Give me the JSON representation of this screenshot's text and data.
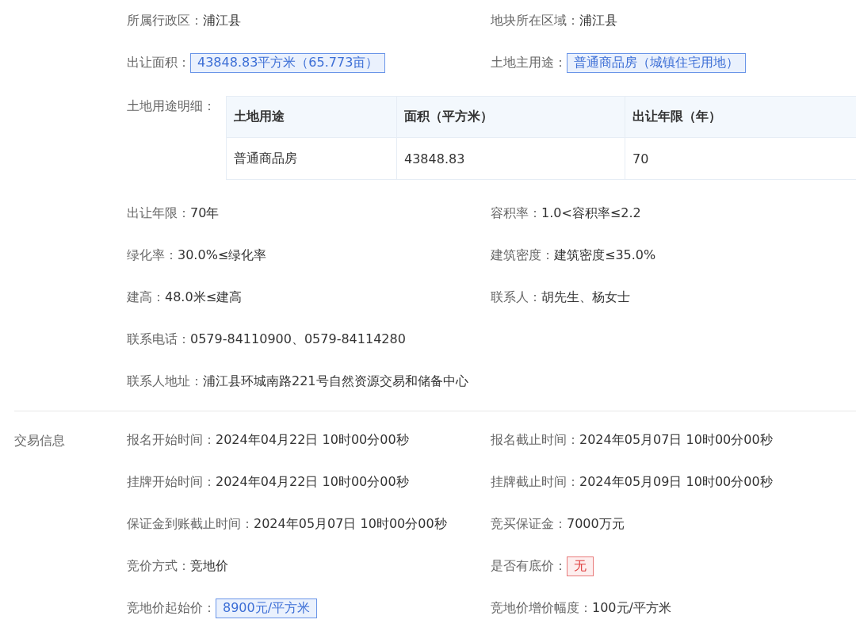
{
  "sections": [
    {
      "items": [
        {
          "kind": "text",
          "label": "所属行政区：",
          "value": "浦江县"
        },
        {
          "kind": "text",
          "label": "地块所在区域：",
          "value": "浦江县"
        },
        {
          "kind": "tag",
          "label": "出让面积：",
          "value": "43848.83平方米（65.773亩）"
        },
        {
          "kind": "tag",
          "label": "土地主用途：",
          "value": "普通商品房（城镇住宅用地）"
        },
        {
          "kind": "table",
          "label": "土地用途明细：",
          "columns": [
            "土地用途",
            "面积（平方米）",
            "出让年限（年）"
          ],
          "rows": [
            [
              "普通商品房",
              "43848.83",
              "70"
            ]
          ]
        },
        {
          "kind": "text",
          "label": "出让年限：",
          "value": "70年"
        },
        {
          "kind": "text",
          "label": "容积率：",
          "value": "1.0<容积率≤2.2"
        },
        {
          "kind": "text",
          "label": "绿化率：",
          "value": "30.0%≤绿化率"
        },
        {
          "kind": "text",
          "label": "建筑密度：",
          "value": "建筑密度≤35.0%"
        },
        {
          "kind": "text",
          "label": "建高：",
          "value": "48.0米≤建高"
        },
        {
          "kind": "text",
          "label": "联系人：",
          "value": "胡先生、杨女士"
        },
        {
          "kind": "wide",
          "label": "联系电话：",
          "value": "0579-84110900、0579-84114280"
        },
        {
          "kind": "wide",
          "label": "联系人地址：",
          "value": "浦江县环城南路221号自然资源交易和储备中心"
        }
      ]
    },
    {
      "title": "交易信息",
      "items": [
        {
          "kind": "text",
          "label": "报名开始时间：",
          "value": "2024年04月22日 10时00分00秒"
        },
        {
          "kind": "text",
          "label": "报名截止时间：",
          "value": "2024年05月07日 10时00分00秒"
        },
        {
          "kind": "text",
          "label": "挂牌开始时间：",
          "value": "2024年04月22日 10时00分00秒"
        },
        {
          "kind": "text",
          "label": "挂牌截止时间：",
          "value": "2024年05月09日 10时00分00秒"
        },
        {
          "kind": "text",
          "label": "保证金到账截止时间：",
          "value": "2024年05月07日 10时00分00秒"
        },
        {
          "kind": "text",
          "label": "竞买保证金：",
          "value": "7000万元"
        },
        {
          "kind": "text",
          "label": "竞价方式：",
          "value": "竞地价"
        },
        {
          "kind": "warning",
          "label": "是否有底价：",
          "value": "无"
        },
        {
          "kind": "tag",
          "label": "竞地价起始价：",
          "value": "8900元/平方米"
        },
        {
          "kind": "text",
          "label": "竞地价增价幅度：",
          "value": "100元/平方米"
        }
      ]
    }
  ]
}
